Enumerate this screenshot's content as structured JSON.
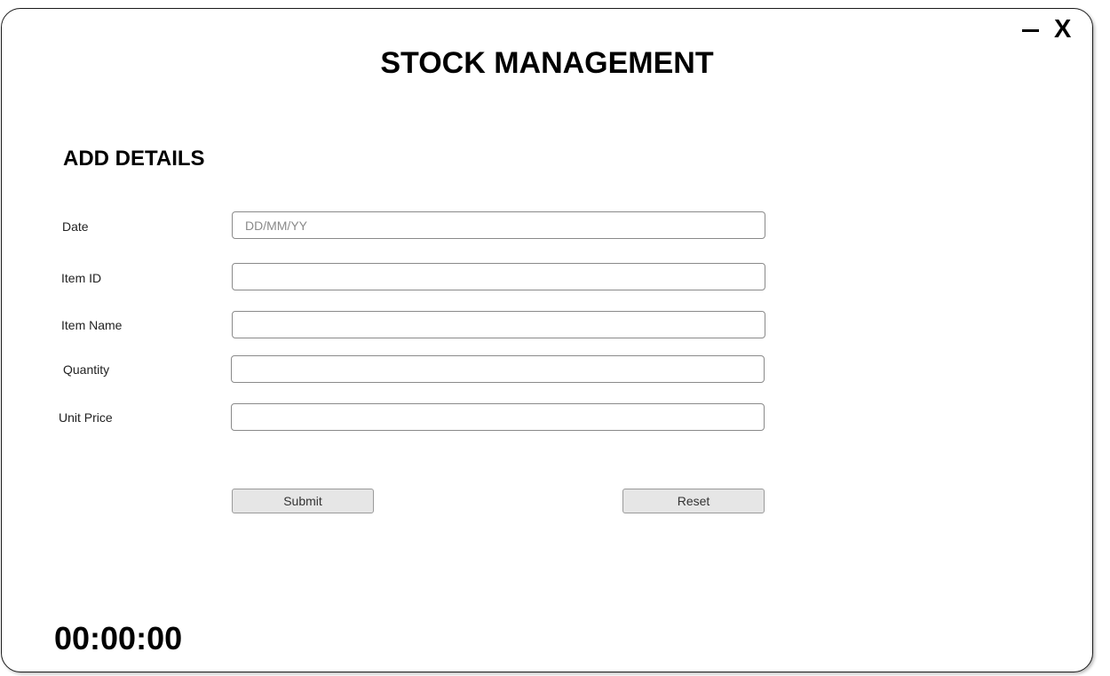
{
  "window": {
    "title": "STOCK MANAGEMENT",
    "minimize_label": "–",
    "close_label": "X"
  },
  "form": {
    "section_title": "ADD DETAILS",
    "fields": [
      {
        "label": "Date",
        "value": "",
        "placeholder": "DD/MM/YY"
      },
      {
        "label": "Item ID",
        "value": "",
        "placeholder": ""
      },
      {
        "label": "Item Name",
        "value": "",
        "placeholder": ""
      },
      {
        "label": "Quantity",
        "value": "",
        "placeholder": ""
      },
      {
        "label": "Unit Price",
        "value": "",
        "placeholder": ""
      }
    ],
    "submit_label": "Submit",
    "reset_label": "Reset"
  },
  "timer": {
    "value": "00:00:00"
  }
}
